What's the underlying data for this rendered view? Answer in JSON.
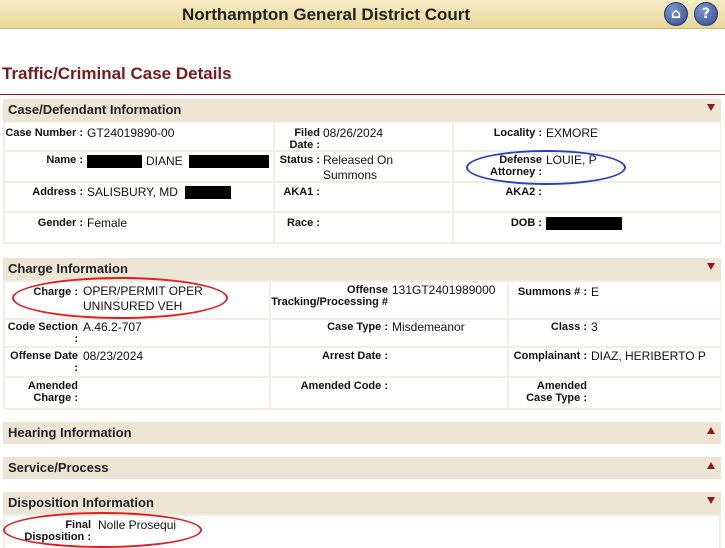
{
  "header": {
    "court_name": "Northampton General District Court"
  },
  "page_title": "Traffic/Criminal Case Details",
  "case_section": {
    "title": "Case/Defendant Information",
    "case_number_label": "Case Number :",
    "case_number": "GT24019890-00",
    "filed_label": "Filed Date :",
    "filed": "08/26/2024",
    "locality_label": "Locality :",
    "locality": "EXMORE",
    "name_label": "Name :",
    "name_middle": "DIANE",
    "status_label": "Status :",
    "status": "Released On Summons",
    "defense_label": "Defense Attorney :",
    "defense": "LOUIE, P",
    "address_label": "Address :",
    "address": "SALISBURY, MD",
    "aka1_label": "AKA1 :",
    "aka2_label": "AKA2 :",
    "gender_label": "Gender :",
    "gender": "Female",
    "race_label": "Race :",
    "dob_label": "DOB :"
  },
  "charge_section": {
    "title": "Charge Information",
    "charge_label": "Charge :",
    "charge": "OPER/PERMIT OPER UNINSURED VEH",
    "otn_label": "Offense Tracking/Processing #",
    "otn": "131GT2401989000",
    "summons_label": "Summons # :",
    "summons": "E",
    "code_label": "Code Section :",
    "code": "A.46.2-707",
    "case_type_label": "Case Type :",
    "case_type": "Misdemeanor",
    "class_label": "Class :",
    "class_value": "3",
    "offense_date_label": "Offense Date :",
    "offense_date": "08/23/2024",
    "arrest_date_label": "Arrest Date :",
    "complainant_label": "Complainant :",
    "complainant": "DIAZ, HERIBERTO P",
    "amended_charge_label": "Amended Charge :",
    "amended_code_label": "Amended Code :",
    "amended_case_type_label": "Amended Case Type :"
  },
  "hearing_section": {
    "title": "Hearing Information"
  },
  "service_section": {
    "title": "Service/Process"
  },
  "disposition_section": {
    "title": "Disposition Information",
    "final_label": "Final Disposition :",
    "final": "Nolle Prosequi"
  },
  "icons": {
    "home": "home-icon",
    "help": "help-icon"
  },
  "colors": {
    "title_red": "#7a1a1a",
    "annotation_red": "#e02020",
    "annotation_blue": "#2b3fbf",
    "header_bg": "#ece5d4"
  }
}
